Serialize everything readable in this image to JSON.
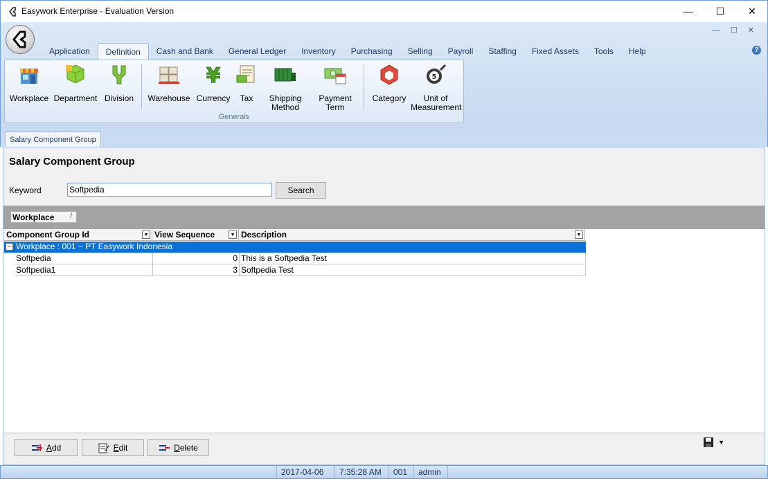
{
  "window": {
    "title": "Easywork Enterprise - Evaluation Version",
    "minimize_glyph": "—",
    "maximize_glyph": "☐",
    "close_glyph": "✕"
  },
  "mdi_controls": "— ☐ ✕",
  "menu": {
    "tabs": [
      "Application",
      "Definition",
      "Cash and Bank",
      "General Ledger",
      "Inventory",
      "Purchasing",
      "Selling",
      "Payroll",
      "Staffing",
      "Fixed Assets",
      "Tools",
      "Help"
    ],
    "active_tab": "Definition",
    "help_icon": "?"
  },
  "ribbon": {
    "group_label": "Generals",
    "items": [
      {
        "label": "Workplace",
        "icon": "workplace-icon"
      },
      {
        "label": "Department",
        "icon": "department-icon"
      },
      {
        "label": "Division",
        "icon": "division-icon"
      },
      {
        "label": "Warehouse",
        "icon": "warehouse-icon"
      },
      {
        "label": "Currency",
        "icon": "currency-icon"
      },
      {
        "label": "Tax",
        "icon": "tax-icon"
      },
      {
        "label": "Shipping Method",
        "line1": "Shipping",
        "line2": "Method",
        "icon": "shipping-icon"
      },
      {
        "label": "Payment Term",
        "line1": "Payment",
        "line2": "Term",
        "icon": "payment-term-icon"
      },
      {
        "label": "Category",
        "icon": "category-icon"
      },
      {
        "label": "Unit of Measurement",
        "line1": "Unit of",
        "line2": "Measurement",
        "icon": "unit-of-measurement-icon"
      }
    ]
  },
  "doc_tab": "Salary Component Group",
  "page": {
    "title": "Salary Component Group",
    "keyword_label": "Keyword",
    "keyword_value": "Softpedia",
    "search_button": "Search"
  },
  "grouping": {
    "chip_label": "Workplace",
    "chip_sort": "/"
  },
  "grid": {
    "columns": [
      "Component Group Id",
      "View Sequence",
      "Description"
    ],
    "dropdown_glyph": "▼",
    "group_row": "Workplace : 001 ~ PT Easywork Indonesia",
    "expander": "−",
    "rows": [
      {
        "id": "Softpedia",
        "seq": "0",
        "desc": "This is a Softpedia Test"
      },
      {
        "id": "Softpedia1",
        "seq": "3",
        "desc": "Softpedia Test"
      }
    ]
  },
  "actions": {
    "add": "Add",
    "edit": "Edit",
    "delete": "Delete",
    "add_mnemonic": "A",
    "add_rest": "dd",
    "edit_mnemonic": "E",
    "edit_rest": "dit",
    "delete_mnemonic": "D",
    "delete_rest": "elete",
    "save_dropdown_glyph": "▼"
  },
  "status": {
    "date": "2017-04-06",
    "time": "7:35:28 AM",
    "code": "001",
    "user": "admin"
  },
  "colors": {
    "selected_row": "#0a72d6",
    "ribbon_bg": "#c6d9f0",
    "accent": "#1e3966"
  }
}
